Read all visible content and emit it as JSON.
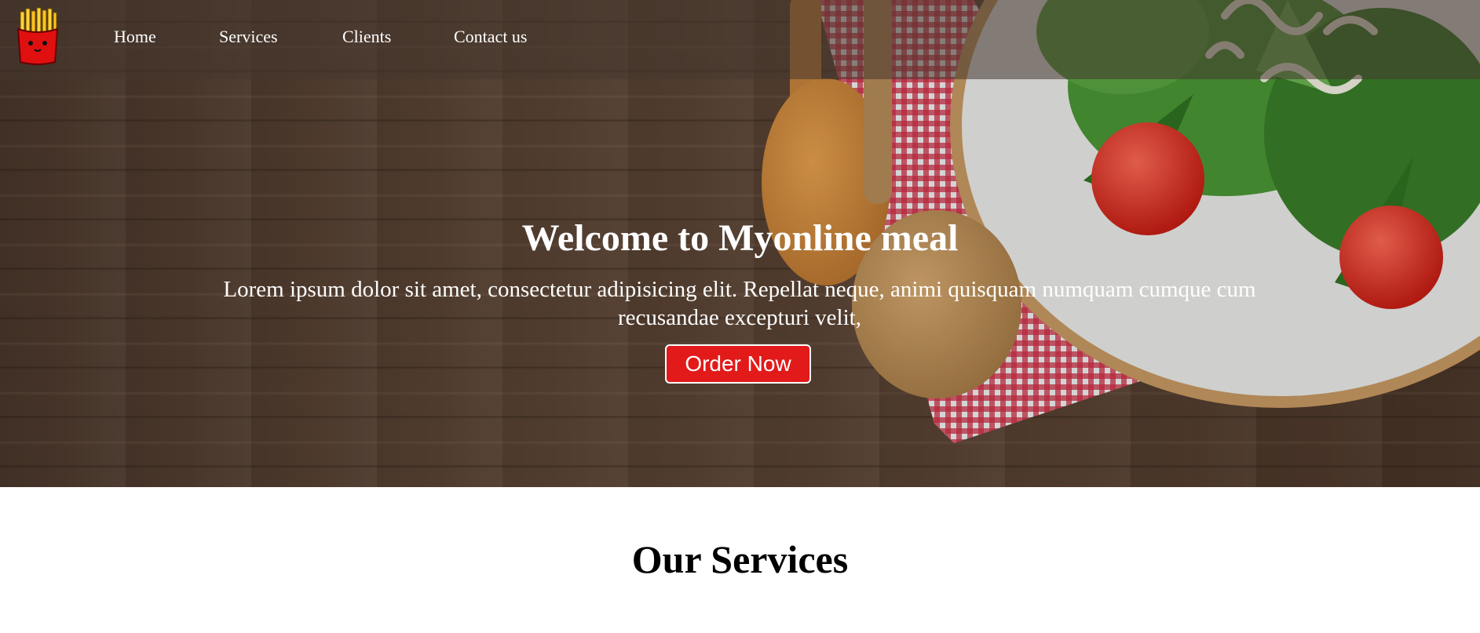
{
  "nav": {
    "logo_icon": "french-fries-icon",
    "links": [
      {
        "label": "Home"
      },
      {
        "label": "Services"
      },
      {
        "label": "Clients"
      },
      {
        "label": "Contact us"
      }
    ]
  },
  "hero": {
    "title": "Welcome to Myonline meal",
    "text": "Lorem ipsum dolor sit amet, consectetur adipisicing elit. Repellat neque, animi quisquam numquam cumque cum recusandae excepturi velit,",
    "button_label": "Order Now",
    "button_color": "#e21a1a",
    "background_image": "wooden-table-with-spoons-and-salad"
  },
  "services": {
    "title": "Our Services"
  }
}
